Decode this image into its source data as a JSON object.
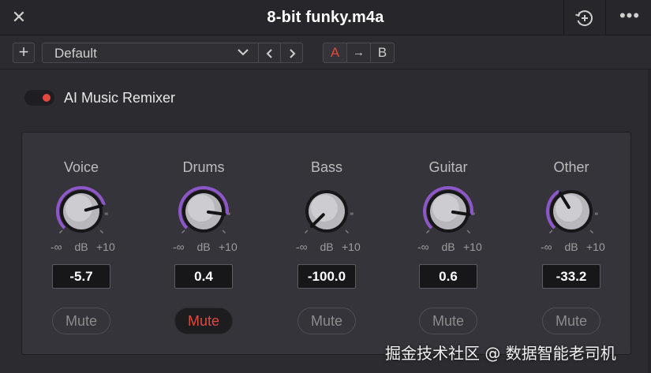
{
  "window": {
    "title": "8-bit funky.m4a",
    "close_glyph": "✕",
    "more_glyph": "•••",
    "history_icon": "history-add-icon"
  },
  "preset_bar": {
    "add_glyph": "+",
    "preset_value": "Default",
    "nav_prev_icon": "chevron-left-icon",
    "nav_next_icon": "chevron-right-icon",
    "ab_a_label": "A",
    "ab_copy_glyph": "→",
    "ab_b_label": "B"
  },
  "remixer": {
    "label": "AI Music Remixer",
    "enabled": true
  },
  "channels": [
    {
      "name": "Voice",
      "db_min": "-∞",
      "db_unit": "dB",
      "db_max": "+10",
      "value": "-5.7",
      "mute_label": "Mute",
      "muted": false
    },
    {
      "name": "Drums",
      "db_min": "-∞",
      "db_unit": "dB",
      "db_max": "+10",
      "value": "0.4",
      "mute_label": "Mute",
      "muted": true
    },
    {
      "name": "Bass",
      "db_min": "-∞",
      "db_unit": "dB",
      "db_max": "+10",
      "value": "-100.0",
      "mute_label": "Mute",
      "muted": false
    },
    {
      "name": "Guitar",
      "db_min": "-∞",
      "db_unit": "dB",
      "db_max": "+10",
      "value": "0.6",
      "mute_label": "Mute",
      "muted": false
    },
    {
      "name": "Other",
      "db_min": "-∞",
      "db_unit": "dB",
      "db_max": "+10",
      "value": "-33.2",
      "mute_label": "Mute",
      "muted": false
    }
  ],
  "colors": {
    "accent_red": "#e2483d",
    "knob_arc": "#8e57c9"
  },
  "watermark": "掘金技术社区 @ 数据智能老司机"
}
